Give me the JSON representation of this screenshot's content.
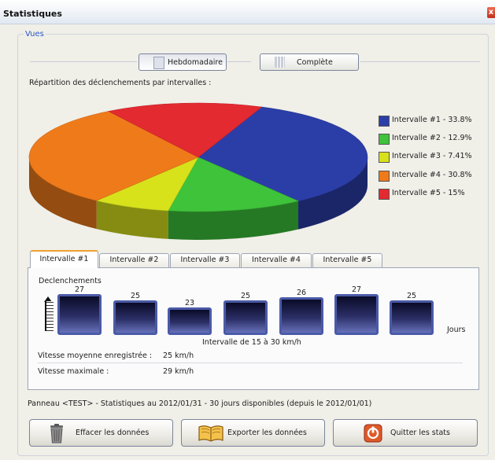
{
  "window": {
    "title": "Statistiques",
    "close_glyph": "x"
  },
  "group": {
    "label": "Vues"
  },
  "views": {
    "weekly_label": "Hebdomadaire",
    "complete_label": "Complète",
    "active": "weekly"
  },
  "pie": {
    "subtitle": "Répartition des déclenchements par intervalles :",
    "legend": [
      {
        "label": "Intervalle #1 - 33.8%",
        "color": "#2b3ea8"
      },
      {
        "label": "Intervalle #2 - 12.9%",
        "color": "#3ec33a"
      },
      {
        "label": "Intervalle #3 - 7.41%",
        "color": "#d7e21b"
      },
      {
        "label": "Intervalle #4 - 30.8%",
        "color": "#ef7a1a"
      },
      {
        "label": "Intervalle #5 - 15%",
        "color": "#e32a31"
      }
    ]
  },
  "chart_data": {
    "type": "pie",
    "categories": [
      "Intervalle #1",
      "Intervalle #2",
      "Intervalle #3",
      "Intervalle #4",
      "Intervalle #5"
    ],
    "values": [
      33.8,
      12.9,
      7.41,
      30.8,
      15
    ],
    "colors": [
      "#2b3ea8",
      "#3ec33a",
      "#d7e21b",
      "#ef7a1a",
      "#e32a31"
    ],
    "legend_position": "right"
  },
  "tabs": [
    "Intervalle #1",
    "Intervalle #2",
    "Intervalle #3",
    "Intervalle #4",
    "Intervalle #5"
  ],
  "active_tab": 0,
  "interval_panel": {
    "title": "Declenchements",
    "bars": [
      27,
      25,
      23,
      25,
      26,
      27,
      25
    ],
    "x_label": "Jours",
    "caption": "Intervalle de 15 à 30 km/h",
    "avg_label": "Vitesse moyenne enregistrée :",
    "avg_value": "25 km/h",
    "max_label": "Vitesse maximale :",
    "max_value": "29 km/h"
  },
  "status_text": "Panneau <TEST> - Statistiques au 2012/01/31 - 30 jours disponibles (depuis le 2012/01/01)",
  "buttons": {
    "clear_label": "Effacer les données",
    "export_label": "Exporter les données",
    "quit_label": "Quitter les stats"
  },
  "icons": {
    "clear": "trash-icon",
    "export": "book-icon",
    "quit": "power-icon",
    "weekly": "document-icon",
    "complete": "grid-icon"
  }
}
